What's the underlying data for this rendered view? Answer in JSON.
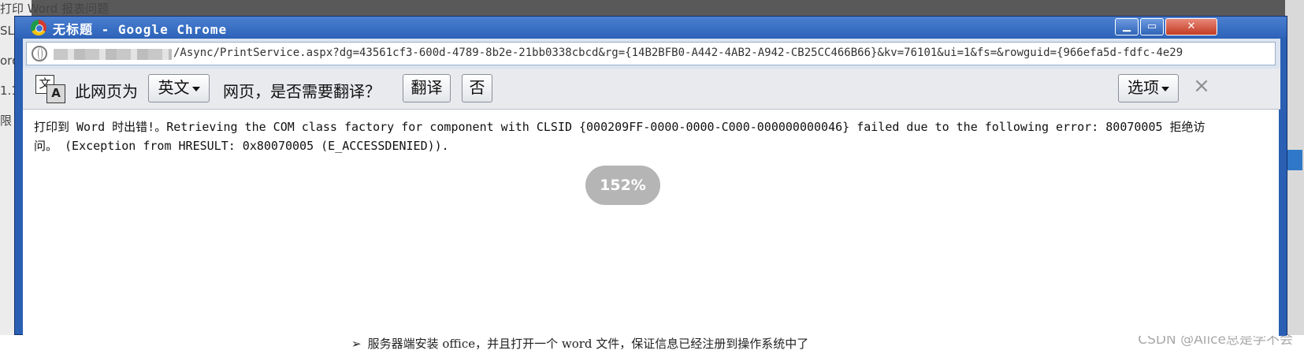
{
  "background": {
    "left_fragments": [
      "打印 Word 报表问题",
      "SL",
      "ord",
      "1.1",
      "限"
    ],
    "bottom_text": "服务器端安装 office，并且打开一个 word 文件，保证信息已经注册到操作系统中了",
    "bullet": "➢",
    "watermark": "CSDN @Alice总是学不会"
  },
  "window": {
    "title": "无标题 - Google Chrome",
    "buttons": {
      "minimize": "▁",
      "maximize": "▭",
      "close": "✕"
    }
  },
  "address_bar": {
    "url": "/Async/PrintService.aspx?dg=43561cf3-600d-4789-8b2e-21bb0338cbcd&rg={14B2BFB0-A442-4AB2-A942-CB25CC466B66}&kv=76101&ui=1&fs=&rowguid={966efa5d-fdfc-4e29"
  },
  "translate_bar": {
    "icon_back": "文",
    "icon_front": "A",
    "prompt_before": "此网页为",
    "language": "英文",
    "prompt_after": "网页，是否需要翻译？",
    "translate_label": "翻译",
    "no_label": "否",
    "options_label": "选项",
    "close_glyph": "×"
  },
  "content": {
    "error_message": "打印到 Word 时出错!。Retrieving the COM class factory for component with CLSID {000209FF-0000-0000-C000-000000000046} failed due to the following error: 80070005 拒绝访问。 (Exception from HRESULT: 0x80070005 (E_ACCESSDENIED)).",
    "zoom": "152%"
  },
  "colors": {
    "titlebar": "#2c62b8",
    "translate_bar": "#e8eaee",
    "zoom_badge": "#b5b5b5"
  }
}
